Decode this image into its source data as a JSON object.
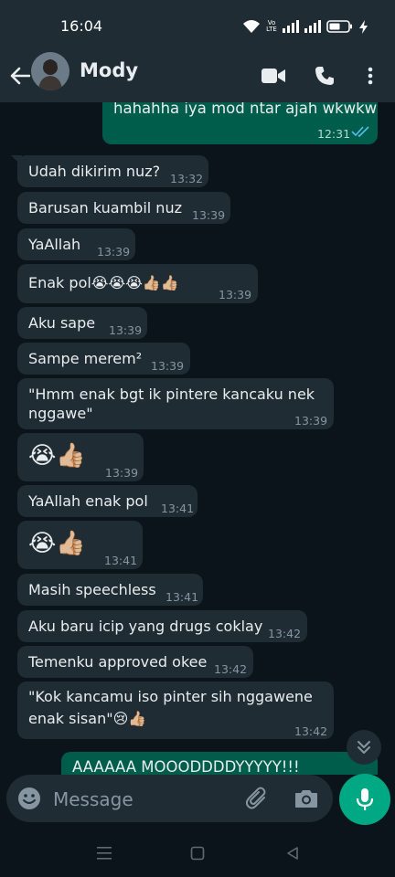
{
  "status_bar": {
    "time": "16:04",
    "volte_label": "Vo LTE"
  },
  "header": {
    "contact_name": "Mody"
  },
  "messages": [
    {
      "dir": "out",
      "text": "hahahha iya mod ntar ajah wkwkw",
      "time": "12:31"
    },
    {
      "dir": "in",
      "text": "Udah dikirim nuz?",
      "time": "13:32"
    },
    {
      "dir": "in",
      "text": "Barusan kuambil nuz",
      "time": "13:39"
    },
    {
      "dir": "in",
      "text": "YaAllah",
      "time": "13:39"
    },
    {
      "dir": "in",
      "text": "Enak pol😭😭😭👍🏼👍🏼",
      "time": "13:39"
    },
    {
      "dir": "in",
      "text": "Aku sape",
      "time": "13:39"
    },
    {
      "dir": "in",
      "text": "Sampe merem²",
      "time": "13:39"
    },
    {
      "dir": "in",
      "text_line1": "\"Hmm enak bgt ik pintere kancaku nek",
      "text_line2": "nggawe\"",
      "time": "13:39"
    },
    {
      "dir": "in",
      "text": "😭👍🏼",
      "time": "13:39"
    },
    {
      "dir": "in",
      "text": "YaAllah enak pol",
      "time": "13:41"
    },
    {
      "dir": "in",
      "text": "😭👍🏼",
      "time": "13:41"
    },
    {
      "dir": "in",
      "text": "Masih speechless",
      "time": "13:41"
    },
    {
      "dir": "in",
      "text": "Aku baru icip yang drugs coklay",
      "time": "13:42"
    },
    {
      "dir": "in",
      "text": "Temenku approved okee",
      "time": "13:42"
    },
    {
      "dir": "in",
      "text_line1": "\"Kok kancamu iso pinter sih nggawene",
      "text_line2": "enak sisan\"😢👍🏼",
      "time": "13:42"
    },
    {
      "dir": "out",
      "text": "AAAAAA MOOODDDDYYYYY!!!",
      "time": ""
    }
  ],
  "input": {
    "placeholder": "Message"
  },
  "icons": {
    "back": "arrow-left-icon",
    "video": "video-camera-icon",
    "call": "phone-icon",
    "menu": "more-vertical-icon",
    "emoji": "emoji-icon",
    "attach": "paperclip-icon",
    "camera": "camera-icon",
    "mic": "microphone-icon",
    "scroll_down": "double-chevron-down-icon"
  },
  "colors": {
    "background": "#0b141a",
    "incoming_bubble": "#1f2c34",
    "outgoing_bubble": "#005c4b",
    "accent": "#00a884",
    "read_ticks": "#53bdeb",
    "secondary_text": "#8696a0"
  }
}
